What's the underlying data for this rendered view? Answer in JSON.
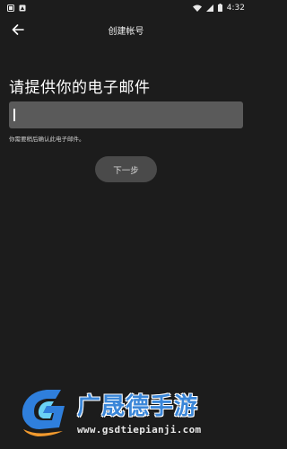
{
  "status_bar": {
    "time": "4:32",
    "left_icons": [
      "notification-icon",
      "notification-icon"
    ],
    "right_icons": [
      "wifi-icon",
      "cellular-icon",
      "battery-icon"
    ]
  },
  "app_bar": {
    "title": "创建帐号",
    "back_icon": "arrow-left-icon"
  },
  "form": {
    "heading": "请提供你的电子邮件",
    "email_value": "",
    "helper_text": "你需要稍后确认此电子邮件。",
    "next_label": "下一步"
  },
  "watermark": {
    "brand": "广晟德手游",
    "url": "www.gsdtiepianji.com"
  },
  "colors": {
    "background": "#1c1c1c",
    "field": "#5a5a5a",
    "button": "#4a4a4a",
    "watermark_blue": "#3a86d8"
  }
}
